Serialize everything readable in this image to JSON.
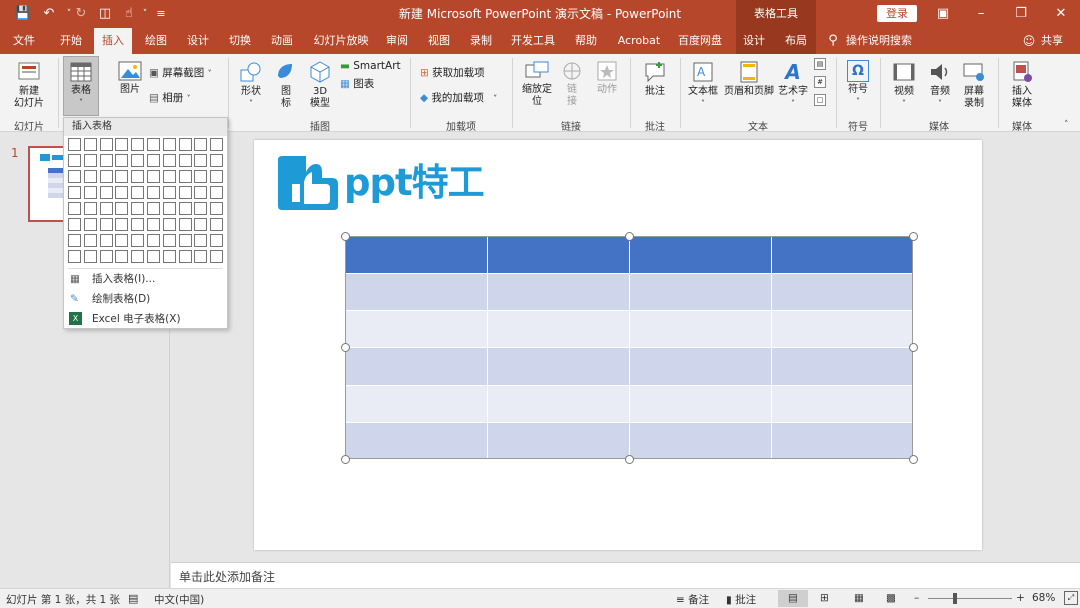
{
  "window": {
    "title": "新建 Microsoft PowerPoint 演示文稿 - PowerPoint",
    "context_title": "表格工具",
    "login_label": "登录"
  },
  "tabs": [
    "文件",
    "开始",
    "插入",
    "绘图",
    "设计",
    "切换",
    "动画",
    "幻灯片放映",
    "审阅",
    "视图",
    "录制",
    "开发工具",
    "帮助",
    "Acrobat",
    "百度网盘",
    "设计",
    "布局"
  ],
  "tell_me": "操作说明搜索",
  "share": "共享",
  "ribbon": {
    "new_slide": "新建\n幻灯片",
    "group_slides": "幻灯片",
    "table": "表格",
    "picture": "图片",
    "screenshot": "屏幕截图",
    "album": "相册",
    "shapes": "形状",
    "icons": "图\n标",
    "model3d": "3D\n模型",
    "smartart": "SmartArt",
    "chart": "图表",
    "group_illustrations": "插图",
    "get_addins": "获取加载项",
    "my_addins": "我的加载项",
    "group_addins": "加载项",
    "zoom": "缩放定\n位",
    "link": "链\n接",
    "action": "动作",
    "group_links": "链接",
    "comment": "批注",
    "group_comments": "批注",
    "textbox": "文本框",
    "header_footer": "页眉和页脚",
    "wordart": "艺术字",
    "group_text": "文本",
    "symbol": "符号",
    "group_symbols": "符号",
    "video": "视频",
    "audio": "音频",
    "screen_record": "屏幕\n录制",
    "group_media": "媒体",
    "insert_media": "插入\n媒体",
    "group_media2": "媒体"
  },
  "dropdown": {
    "header": "插入表格",
    "items": [
      "插入表格(I)...",
      "绘制表格(D)",
      "Excel 电子表格(X)"
    ]
  },
  "slide_pane": {
    "number": "1"
  },
  "slide": {
    "logo_text": "ppt特工"
  },
  "notes_placeholder": "单击此处添加备注",
  "status": {
    "slide_info": "幻灯片 第 1 张，共 1 张",
    "language": "中文(中国)",
    "notes": "备注",
    "comments": "批注",
    "zoom": "68%"
  },
  "colors": {
    "brand": "#b7472a",
    "table_header": "#4472c4",
    "table_band_dark": "#cfd5ea",
    "table_band_light": "#e9ebf5"
  }
}
